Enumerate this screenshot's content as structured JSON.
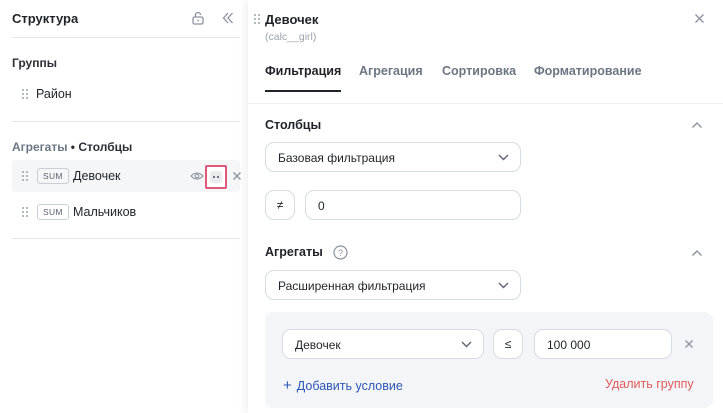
{
  "left": {
    "title": "Структура",
    "groups_title": "Группы",
    "groups": [
      {
        "label": "Район"
      }
    ],
    "aggs_title_prefix": "Агрегаты",
    "aggs_title_sep": " • ",
    "aggs_title_suffix": "Столбцы",
    "fields": [
      {
        "badge": "SUM",
        "label": "Девочек"
      },
      {
        "badge": "SUM",
        "label": "Мальчиков"
      }
    ]
  },
  "right": {
    "title": "Девочек",
    "subtitle": "(calc__girl)",
    "tabs": [
      {
        "label": "Фильтрация"
      },
      {
        "label": "Агрегация"
      },
      {
        "label": "Сортировка"
      },
      {
        "label": "Форматирование"
      }
    ],
    "columns": {
      "title": "Столбцы",
      "filter_type": "Базовая фильтрация",
      "operator": "≠",
      "value": "0"
    },
    "aggregates": {
      "title": "Агрегаты",
      "help": "?",
      "filter_type": "Расширенная фильтрация",
      "condition": {
        "field": "Девочек",
        "operator": "≤",
        "value": "100 000"
      },
      "add_condition": "Добавить условие",
      "add_condition_icon": "+",
      "delete_group": "Удалить группу"
    }
  },
  "colors": {
    "highlight_border": "#e0587a",
    "link_blue": "#2d57b5",
    "danger_red": "#e05a5a",
    "group_bg": "#f3f5f8"
  }
}
